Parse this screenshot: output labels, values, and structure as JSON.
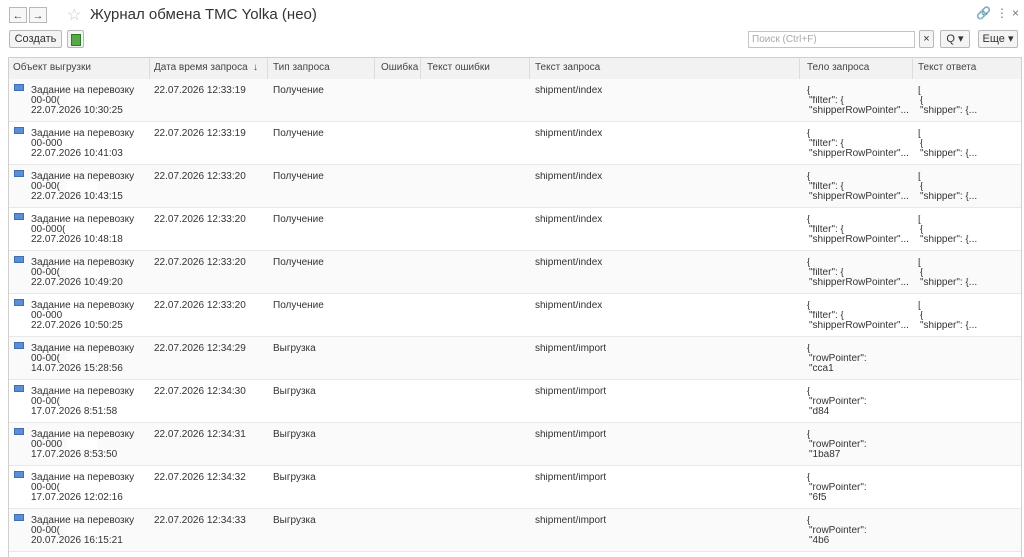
{
  "window": {
    "back_icon": "←",
    "forward_icon": "→",
    "star_icon": "☆",
    "title": "Журнал обмена ТМС Yolka (нео)",
    "link_icon": "🔗",
    "more_icon": "⋮",
    "close_icon": "×"
  },
  "toolbar": {
    "create_label": "Создать",
    "search_placeholder": "Поиск (Ctrl+F)",
    "clear_icon": "×",
    "search_icon": "Q",
    "more_label": "Еще"
  },
  "columns": [
    "Объект выгрузки",
    "Дата время запроса",
    "Тип запроса",
    "Ошибка",
    "Текст ошибки",
    "Текст запроса",
    "Тело запроса",
    "Текст ответа"
  ],
  "rows": [
    {
      "obj1": "Задание на перевозку",
      "obj2": "00-00(",
      "obj3": "22.07.2026 10:30:25",
      "date": "22.07.2026 12:33:19",
      "type": "Получение",
      "req": "shipment/index",
      "body1": "{",
      "body2": "\"filter\": {",
      "body3": "\"shipperRowPointer\"...",
      "resp1": "[",
      "resp2": "{",
      "resp3": "\"shipper\": {..."
    },
    {
      "obj1": "Задание на перевозку",
      "obj2": "00-000",
      "obj3": "22.07.2026 10:41:03",
      "date": "22.07.2026 12:33:19",
      "type": "Получение",
      "req": "shipment/index",
      "body1": "{",
      "body2": "\"filter\": {",
      "body3": "\"shipperRowPointer\"...",
      "resp1": "[",
      "resp2": "{",
      "resp3": "\"shipper\": {..."
    },
    {
      "obj1": "Задание на перевозку",
      "obj2": "00-00(",
      "obj3": "22.07.2026 10:43:15",
      "date": "22.07.2026 12:33:20",
      "type": "Получение",
      "req": "shipment/index",
      "body1": "{",
      "body2": "\"filter\": {",
      "body3": "\"shipperRowPointer\"...",
      "resp1": "[",
      "resp2": "{",
      "resp3": "\"shipper\": {..."
    },
    {
      "obj1": "Задание на перевозку",
      "obj2": "00-000(",
      "obj3": "22.07.2026 10:48:18",
      "date": "22.07.2026 12:33:20",
      "type": "Получение",
      "req": "shipment/index",
      "body1": "{",
      "body2": "\"filter\": {",
      "body3": "\"shipperRowPointer\"...",
      "resp1": "[",
      "resp2": "{",
      "resp3": "\"shipper\": {..."
    },
    {
      "obj1": "Задание на перевозку",
      "obj2": "00-00(",
      "obj3": "22.07.2026 10:49:20",
      "date": "22.07.2026 12:33:20",
      "type": "Получение",
      "req": "shipment/index",
      "body1": "{",
      "body2": "\"filter\": {",
      "body3": "\"shipperRowPointer\"...",
      "resp1": "[",
      "resp2": "{",
      "resp3": "\"shipper\": {..."
    },
    {
      "obj1": "Задание на перевозку",
      "obj2": "00-000",
      "obj3": "22.07.2026 10:50:25",
      "date": "22.07.2026 12:33:20",
      "type": "Получение",
      "req": "shipment/index",
      "body1": "{",
      "body2": "\"filter\": {",
      "body3": "\"shipperRowPointer\"...",
      "resp1": "[",
      "resp2": "{",
      "resp3": "\"shipper\": {..."
    },
    {
      "obj1": "Задание на перевозку",
      "obj2": "00-00(",
      "obj3": "14.07.2026 15:28:56",
      "date": "22.07.2026 12:34:29",
      "type": "Выгрузка",
      "req": "shipment/import",
      "body1": "{",
      "body2": "\"rowPointer\":",
      "body3": "\"cca1",
      "resp1": "",
      "resp2": "",
      "resp3": ""
    },
    {
      "obj1": "Задание на перевозку",
      "obj2": "00-00(",
      "obj3": "17.07.2026 8:51:58",
      "date": "22.07.2026 12:34:30",
      "type": "Выгрузка",
      "req": "shipment/import",
      "body1": "{",
      "body2": "\"rowPointer\":",
      "body3": "\"d84",
      "resp1": "",
      "resp2": "",
      "resp3": ""
    },
    {
      "obj1": "Задание на перевозку",
      "obj2": "00-000",
      "obj3": "17.07.2026 8:53:50",
      "date": "22.07.2026 12:34:31",
      "type": "Выгрузка",
      "req": "shipment/import",
      "body1": "{",
      "body2": "\"rowPointer\":",
      "body3": "\"1ba87",
      "resp1": "",
      "resp2": "",
      "resp3": ""
    },
    {
      "obj1": "Задание на перевозку",
      "obj2": "00-00(",
      "obj3": "17.07.2026 12:02:16",
      "date": "22.07.2026 12:34:32",
      "type": "Выгрузка",
      "req": "shipment/import",
      "body1": "{",
      "body2": "\"rowPointer\":",
      "body3": "\"6f5",
      "resp1": "",
      "resp2": "",
      "resp3": ""
    },
    {
      "obj1": "Задание на перевозку",
      "obj2": "00-00(",
      "obj3": "20.07.2026 16:15:21",
      "date": "22.07.2026 12:34:33",
      "type": "Выгрузка",
      "req": "shipment/import",
      "body1": "{",
      "body2": "\"rowPointer\":",
      "body3": "\"4b6",
      "resp1": "",
      "resp2": "",
      "resp3": ""
    }
  ]
}
